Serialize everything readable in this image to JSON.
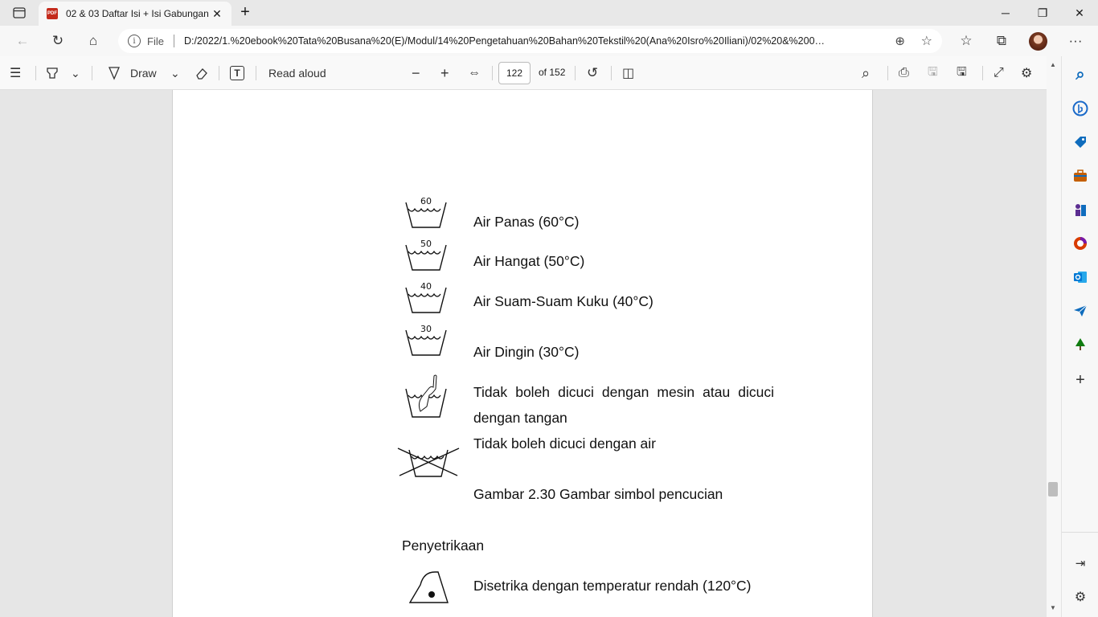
{
  "browser": {
    "tab": {
      "icon": "pdf-icon",
      "icon_text": "PDF",
      "title": "02 & 03 Daftar Isi + Isi Gabungan",
      "close": "✕"
    },
    "new_tab": "+",
    "window": {
      "minimize": "─",
      "maximize": "❐",
      "close": "✕"
    }
  },
  "address": {
    "back": "←",
    "refresh": "↻",
    "home": "⌂",
    "info": "i",
    "scheme_label": "File",
    "url": "D:/2022/1.%20ebook%20Tata%20Busana%20(E)/Modul/14%20Pengetahuan%20Bahan%20Tekstil%20(Ana%20Isro%20Iliani)/02%20&%200…",
    "zoom_icon": "⊕",
    "favorite_icon": "☆",
    "favorites": "☆",
    "collections": "⧉",
    "more": "···"
  },
  "pdf_toolbar": {
    "contents": "☰",
    "highlight_caret": "⌄",
    "draw_label": "Draw",
    "draw_caret": "⌄",
    "erase": "⌫",
    "text": "T",
    "read_aloud": "Read aloud",
    "zoom_out": "−",
    "zoom_in": "+",
    "fit": "⇔",
    "page_number": "122",
    "page_total": "of 152",
    "rotate": "↺",
    "page_view": "◫",
    "search": "⌕",
    "print": "⎙",
    "save": "🖫",
    "save_as": "🖫",
    "fullscreen": "⤢",
    "settings": "⚙"
  },
  "document": {
    "wash_items": [
      {
        "temp": "60",
        "label": "Air Panas (60°C)"
      },
      {
        "temp": "50",
        "label": "Air Hangat (50°C)"
      },
      {
        "temp": "40",
        "label": "Air Suam-Suam Kuku (40°C)"
      },
      {
        "temp": "30",
        "label": "Air Dingin (30°C)"
      }
    ],
    "hand_wash_line1": "Tidak boleh dicuci dengan mesin atau dicuci",
    "hand_wash_line2": "dengan tangan",
    "no_wash": "Tidak boleh dicuci dengan air",
    "caption": "Gambar 2.30 Gambar simbol pencucian",
    "section_heading": "Penyetrikaan",
    "iron_low": "Disetrika dengan temperatur rendah (120°C)"
  },
  "sidebar": {
    "search": "⌕",
    "add": "+",
    "customize": "⇥",
    "settings": "⚙",
    "colors": {
      "bing": "#1b6ac9",
      "shopping": "#0f6cbd",
      "tools": "#c45f00",
      "games": "#5c2e91",
      "office": "#d83b01",
      "outlook": "#0078d4",
      "send": "#0f6cbd",
      "tree": "#107c10"
    }
  },
  "scrollbar": {
    "up": "▲",
    "down": "▼"
  }
}
